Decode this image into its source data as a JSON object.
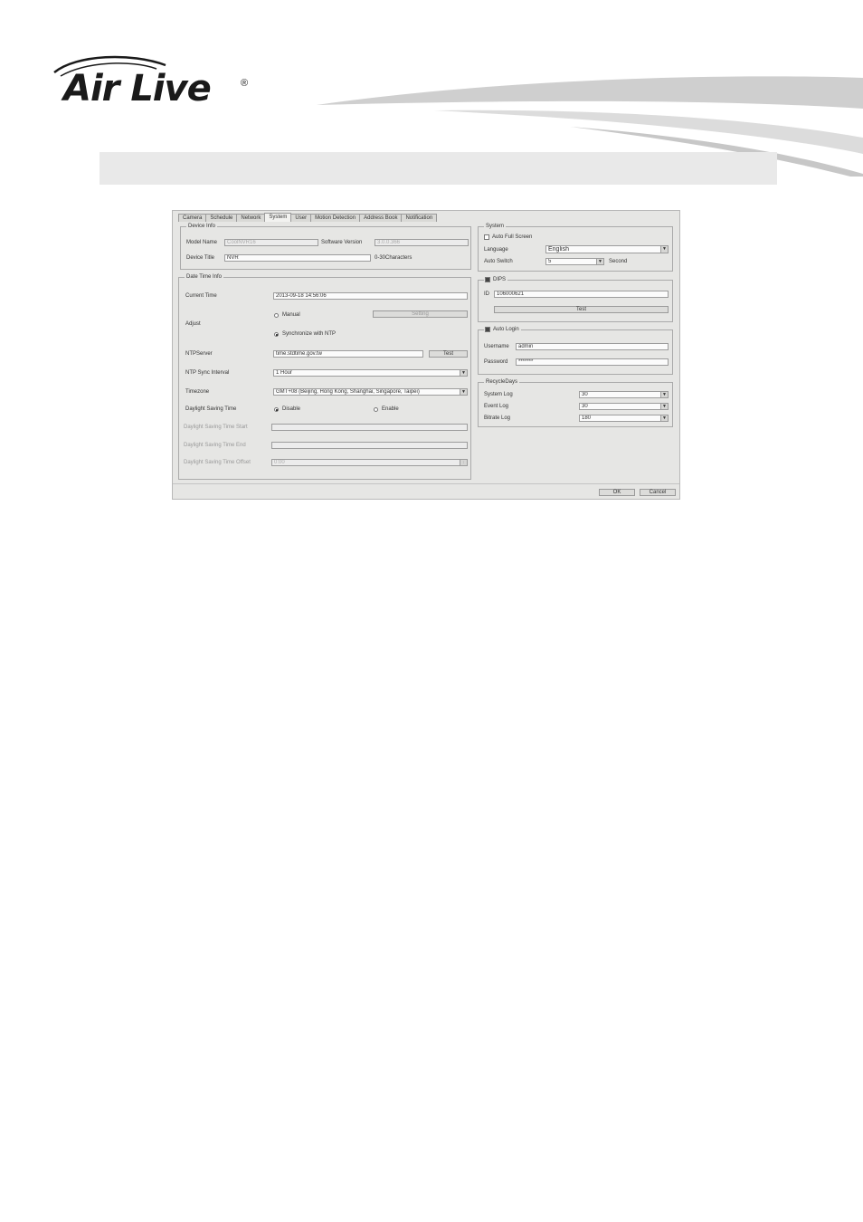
{
  "logo": {
    "text": "Air Live",
    "registered": "®"
  },
  "header_band": "",
  "tabs": [
    "Camera",
    "Schedule",
    "Network",
    "System",
    "User",
    "Motion Detection",
    "Address Book",
    "Notification"
  ],
  "device_info": {
    "title": "Device Info",
    "model_name_label": "Model Name",
    "model_name_value": "CoolNVR16",
    "software_version_label": "Software Version",
    "software_version_value": "3.0.0.366",
    "device_title_label": "Device Title",
    "device_title_value": "NVR",
    "device_title_hint": "0-30Characters"
  },
  "date_time": {
    "title": "Date Time Info",
    "current_time_label": "Current Time",
    "current_time_value": "2013-09-18 14:56:06",
    "adjust_label": "Adjust",
    "manual_label": "Manual",
    "setting_button": "Setting",
    "sync_label": "Synchronize with NTP",
    "ntp_server_label": "NTPServer",
    "ntp_server_value": "time.stdtime.gov.tw",
    "test_button": "Test",
    "ntp_interval_label": "NTP Sync Interval",
    "ntp_interval_value": "1 Hour",
    "timezone_label": "Timezone",
    "timezone_value": "GMT+08 (Beijing, Hong Kong, Shanghai, Singapore, Taipei)",
    "dst_label": "Daylight Saving Time",
    "disable_label": "Disable",
    "enable_label": "Enable",
    "dst_start_label": "Daylight Saving Time Start",
    "dst_end_label": "Daylight Saving Time End",
    "dst_offset_label": "Daylight Saving Time Offset",
    "dst_offset_value": "0:00"
  },
  "system": {
    "title": "System",
    "auto_full_screen_label": "Auto Full Screen",
    "language_label": "Language",
    "language_value": "English",
    "auto_switch_label": "Auto Switch",
    "auto_switch_value": "5",
    "second_label": "Second"
  },
  "dips": {
    "title": "DIPS",
    "id_label": "ID",
    "id_value": "106000621",
    "test_button": "Test"
  },
  "auto_login": {
    "title": "Auto Login",
    "username_label": "Username",
    "username_value": "admin",
    "password_label": "Password",
    "password_value": "*******"
  },
  "recycle": {
    "title": "RecycleDays",
    "system_log_label": "System Log",
    "system_log_value": "30",
    "event_log_label": "Event Log",
    "event_log_value": "30",
    "bitrate_log_label": "Bitrate Log",
    "bitrate_log_value": "180"
  },
  "footer": {
    "ok": "OK",
    "cancel": "Cancel"
  }
}
